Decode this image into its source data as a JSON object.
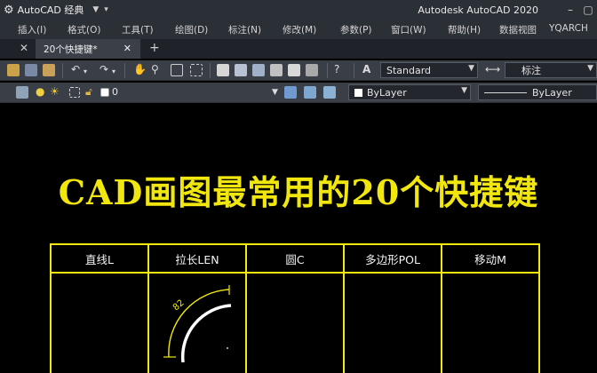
{
  "titlebar": {
    "app_title": "AutoCAD 经典",
    "product": "Autodesk AutoCAD 2020",
    "icons": [
      "gear-icon",
      "save-icon",
      "dropdown-arrow-icon",
      "minimize-icon",
      "restore-icon"
    ]
  },
  "menubar": {
    "items": [
      "插入(I)",
      "格式(O)",
      "工具(T)",
      "绘图(D)",
      "标注(N)",
      "修改(M)",
      "参数(P)",
      "窗口(W)",
      "帮助(H)",
      "数据视图",
      "YQARCH"
    ]
  },
  "tabs": {
    "document": "20个快捷键*"
  },
  "toolbar1": {
    "text_style": "Standard",
    "dim_style": "标注"
  },
  "toolbar2": {
    "layer": "0",
    "color": "ByLayer",
    "linetype": "ByLayer"
  },
  "drawing": {
    "title": "CAD画图最常用的20个快捷键",
    "table_headers": [
      "直线L",
      "拉长LEN",
      "圆C",
      "多边形POL",
      "移动M"
    ],
    "arc_dim_label": "82"
  },
  "colors": {
    "title_yellow": "#f2e60f",
    "table_line": "#f4e80c",
    "ui_dark": "#2b2f36",
    "canvas": "#000000"
  }
}
